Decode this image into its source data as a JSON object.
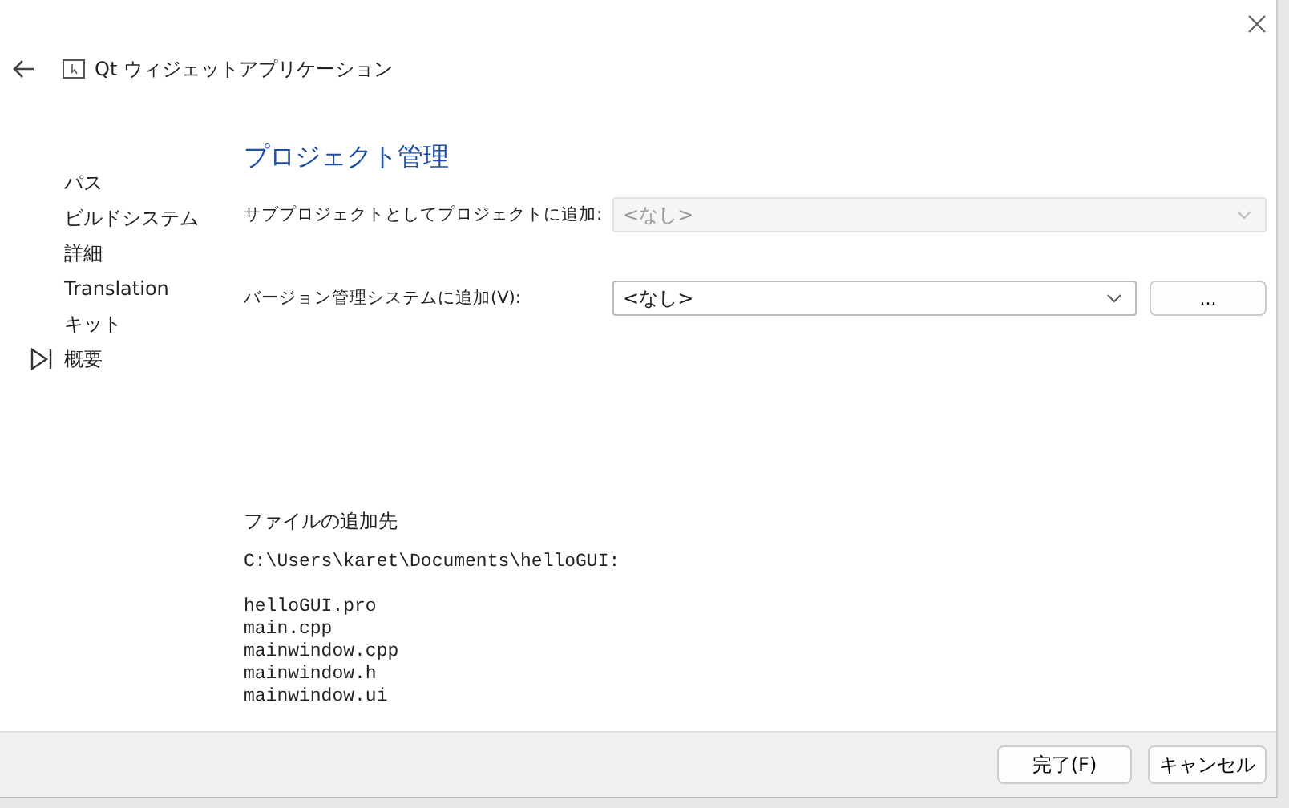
{
  "header": {
    "title": "Qt ウィジェットアプリケーション"
  },
  "steps": [
    {
      "label": "パス",
      "selected": false
    },
    {
      "label": "ビルドシステム",
      "selected": false
    },
    {
      "label": "詳細",
      "selected": false
    },
    {
      "label": "Translation",
      "selected": false
    },
    {
      "label": "キット",
      "selected": false
    },
    {
      "label": "概要",
      "selected": true
    }
  ],
  "page_title": "プロジェクト管理",
  "fields": [
    {
      "label": "サブプロジェクトとしてプロジェクトに追加:",
      "value": "<なし>",
      "disabled": true
    },
    {
      "label": "バージョン管理システムに追加(V):",
      "value": "<なし>",
      "disabled": false,
      "button": "..."
    }
  ],
  "files": {
    "heading": "ファイルの追加先",
    "path": "C:\\Users\\karet\\Documents\\helloGUI:",
    "items": [
      "helloGUI.pro",
      "main.cpp",
      "mainwindow.cpp",
      "mainwindow.h",
      "mainwindow.ui"
    ]
  },
  "buttons": [
    "完了(F)",
    "キャンセル"
  ]
}
